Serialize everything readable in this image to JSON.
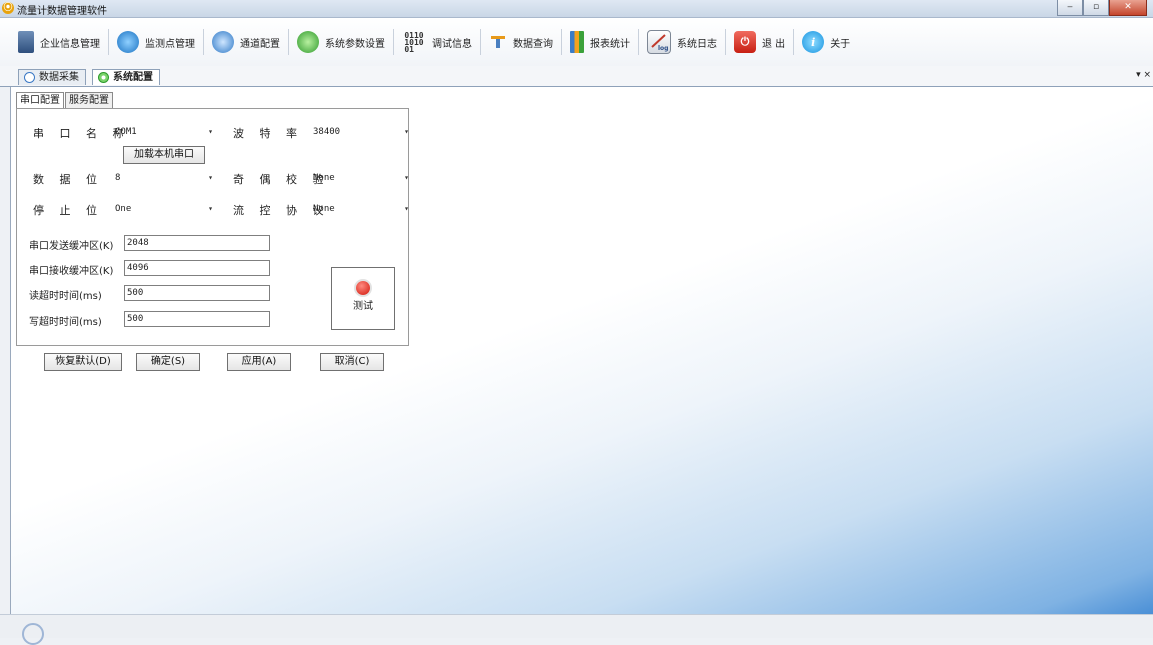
{
  "window": {
    "title": "流量计数据管理软件",
    "icon": "app-logo-icon",
    "controls": [
      "‒",
      "▫",
      "✕"
    ]
  },
  "toolbar": {
    "items": [
      {
        "label": "企业信息管理",
        "icon": "company-icon"
      },
      {
        "label": "监测点管理",
        "icon": "monitor-point-icon"
      },
      {
        "label": "通道配置",
        "icon": "channel-config-icon"
      },
      {
        "label": "系统参数设置",
        "icon": "system-param-icon"
      },
      {
        "label": "调试信息",
        "icon": "debug-binary-icon"
      },
      {
        "label": "数据查询",
        "icon": "data-query-icon"
      },
      {
        "label": "报表统计",
        "icon": "report-chart-icon"
      },
      {
        "label": "系统日志",
        "icon": "log-icon"
      },
      {
        "label": "退 出",
        "icon": "power-icon"
      },
      {
        "label": "关于",
        "icon": "info-icon"
      }
    ],
    "debug_icon_text": "0110\n1010\n01"
  },
  "doc_tabs": [
    {
      "label": "数据采集",
      "active": false
    },
    {
      "label": "系统配置",
      "active": true
    }
  ],
  "doc_tabs_menu": "▾ ×",
  "sub_tabs": [
    {
      "label": "串口配置",
      "active": true
    },
    {
      "label": "服务配置",
      "active": false
    }
  ],
  "serial": {
    "port_name_label": "串 口 名 称",
    "port_name_value": "COM1",
    "baud_label": "波 特 率",
    "baud_value": "38400",
    "load_ports_button": "加载本机串口",
    "data_bits_label": "数 据 位",
    "data_bits_value": "8",
    "parity_label": "奇 偶 校 验",
    "parity_value": "None",
    "stop_bits_label": "停 止 位",
    "stop_bits_value": "One",
    "flow_label": "流 控 协 议",
    "flow_value": "None",
    "send_buffer_label": "串口发送缓冲区(K)",
    "send_buffer_value": "2048",
    "recv_buffer_label": "串口接收缓冲区(K)",
    "recv_buffer_value": "4096",
    "read_timeout_label": "读超时时间(ms)",
    "read_timeout_value": "500",
    "write_timeout_label": "写超时时间(ms)",
    "write_timeout_value": "500",
    "test_button": "测试"
  },
  "actions": {
    "restore": "恢复默认(D)",
    "ok": "确定(S)",
    "apply": "应用(A)",
    "cancel": "取消(C)"
  },
  "dropdown_arrow": "▾"
}
